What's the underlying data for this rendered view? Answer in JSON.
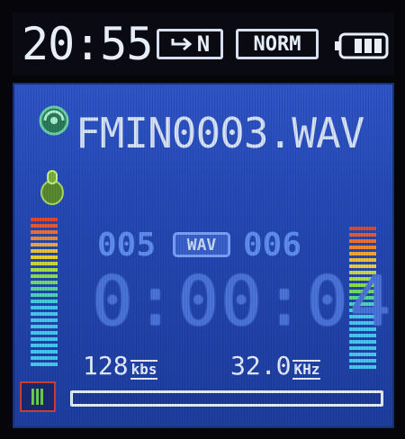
{
  "status_bar": {
    "clock": "20:55",
    "repeat_mode": "N",
    "eq_mode": "NORM",
    "battery_icon": "battery-full-icon"
  },
  "file": {
    "source_icon": "fm-radio-icon",
    "recorder_icon": "microphone-icon",
    "name": "FMIN0003.WAV"
  },
  "track": {
    "current": "005",
    "format": "WAV",
    "total": "006"
  },
  "elapsed": "0:00:04",
  "bitrate": {
    "value": "128",
    "unit": "kbs"
  },
  "sample_rate": {
    "value": "32.0",
    "unit": "KHz"
  },
  "progress": 0.0,
  "colors": {
    "panel": "#2448b4",
    "meter_low": "#46c8f0",
    "meter_mid": "#8ae048",
    "meter_high": "#f0c038",
    "meter_peak": "#e04830"
  }
}
